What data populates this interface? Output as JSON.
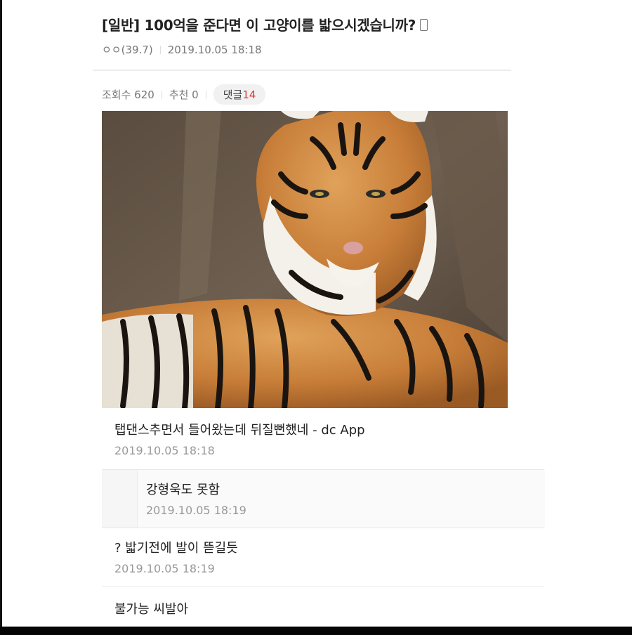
{
  "post": {
    "title": "[일반] 100억을 준다면 이 고양이를 밟으시겠습니까?",
    "author": "ㅇㅇ(39.7)",
    "datetime": "2019.10.05 18:18",
    "views": "조회수 620",
    "recommend": "추천 0",
    "comments_label": "댓글",
    "comments_count": "14"
  },
  "comments": [
    {
      "text": "탭댄스추면서 들어왔는데 뒤질뻔했네 - dc App",
      "date": "2019.10.05 18:18"
    },
    {
      "text": "강형욱도 못함",
      "date": "2019.10.05 18:19"
    },
    {
      "text": "? 밟기전에 발이 뜯길듯",
      "date": "2019.10.05 18:19"
    },
    {
      "text": "불가능 씨발아"
    }
  ],
  "colors": {
    "accent_count": "#d23c3c",
    "text_primary": "#222222",
    "text_meta": "#999999"
  }
}
